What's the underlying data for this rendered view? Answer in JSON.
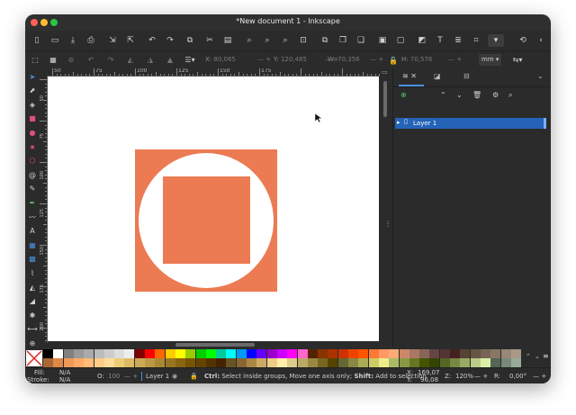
{
  "window": {
    "title": "*New document 1 - Inkscape"
  },
  "traffic_lights": {
    "close": "#ff5f57",
    "minimize": "#febc2e",
    "zoom": "#28c840"
  },
  "toolbar": {
    "icons": [
      "new-document-icon",
      "open-icon",
      "save-icon",
      "print-icon",
      "import-icon",
      "export-icon",
      "undo-icon",
      "redo-icon",
      "copy-icon",
      "cut-icon",
      "paste-icon",
      "zoom-selection-icon",
      "zoom-drawing-icon",
      "zoom-page-icon",
      "zoom-fit-icon",
      "duplicate-icon",
      "clone-icon",
      "unlink-clone-icon",
      "group-icon",
      "ungroup-icon",
      "fill-stroke-icon",
      "text-icon",
      "align-icon",
      "xml-editor-icon",
      "more-dropdown-icon",
      "rotate-icon",
      "collapse-icon"
    ]
  },
  "controls": {
    "x_label": "X:",
    "x_value": "80,065",
    "y_label": "Y:",
    "y_value": "120,485",
    "w_label": "W:",
    "w_value": "70,356",
    "h_label": "H:",
    "h_value": "70,576",
    "units": "mm"
  },
  "ruler": {
    "h_ticks": [
      "50",
      "75",
      "100",
      "125",
      "150",
      "175"
    ],
    "v_ticks": [
      "50",
      "75",
      "100",
      "125",
      "150",
      "175",
      "200"
    ]
  },
  "canvas": {
    "shape_color": "#ec7a52",
    "background": "#ffffff"
  },
  "panel": {
    "tabs": [
      "layers-objects-tab-icon",
      "fill-stroke-tab-icon",
      "align-tab-icon"
    ],
    "layer_row": {
      "name": "Layer 1"
    }
  },
  "palette": {
    "row1": [
      "#000000",
      "#ffffff",
      "#808080",
      "#999999",
      "#aaaaaa",
      "#bbbbbb",
      "#cccccc",
      "#dddddd",
      "#eeeeee",
      "#800000",
      "#ff0000",
      "#ff6600",
      "#ffcc00",
      "#ffff00",
      "#99cc00",
      "#00cc00",
      "#00ff00",
      "#00cc99",
      "#00ffff",
      "#0099ff",
      "#0000ff",
      "#6600ff",
      "#9900cc",
      "#cc00ff",
      "#ff00ff",
      "#ff66cc",
      "#552200",
      "#883300",
      "#aa3300",
      "#cc3300",
      "#ee4400",
      "#ff5500",
      "#ff7733",
      "#ff9966",
      "#ffaa77",
      "#cc8866",
      "#aa7766",
      "#886655",
      "#664444",
      "#553333",
      "#442222",
      "#554433",
      "#665544",
      "#776655",
      "#887766",
      "#998877",
      "#aa9988"
    ],
    "row2": [
      "#aa6633",
      "#dd8844",
      "#ee9955",
      "#ffaa66",
      "#ffbb77",
      "#ffcc88",
      "#ffdd99",
      "#eecc77",
      "#ddbb66",
      "#ccaa55",
      "#bb9944",
      "#aa8833",
      "#997722",
      "#886611",
      "#775500",
      "#664400",
      "#553300",
      "#442200",
      "#665522",
      "#886633",
      "#aa8844",
      "#ccaa66",
      "#eecc88",
      "#ffeeaa",
      "#ddcc88",
      "#bbaa66",
      "#998844",
      "#776622",
      "#554400",
      "#666633",
      "#888844",
      "#aaaa55",
      "#cccc66",
      "#eeee88",
      "#aabb66",
      "#889944",
      "#667722",
      "#445500",
      "#334400",
      "#556622",
      "#778844",
      "#99aa66",
      "#bbcc88",
      "#ddeeaa",
      "#556655",
      "#778877",
      "#99aa99"
    ]
  },
  "status": {
    "fill_label": "Fill:",
    "fill_value": "N/A",
    "stroke_label": "Stroke:",
    "stroke_value": "N/A",
    "opacity_label": "O:",
    "opacity_value": "100",
    "layer": "Layer 1",
    "message_bold1": "Ctrl:",
    "message_text1": " Select inside groups, Move one axis only; ",
    "message_bold2": "Shift:",
    "message_text2": " Add to selection",
    "x_label": "X:",
    "x_value": "169,07",
    "y_label": "Y:",
    "y_value": "96,08",
    "z_label": "Z:",
    "zoom_value": "120%",
    "r_label": "R:",
    "rotation_value": "0,00°"
  }
}
